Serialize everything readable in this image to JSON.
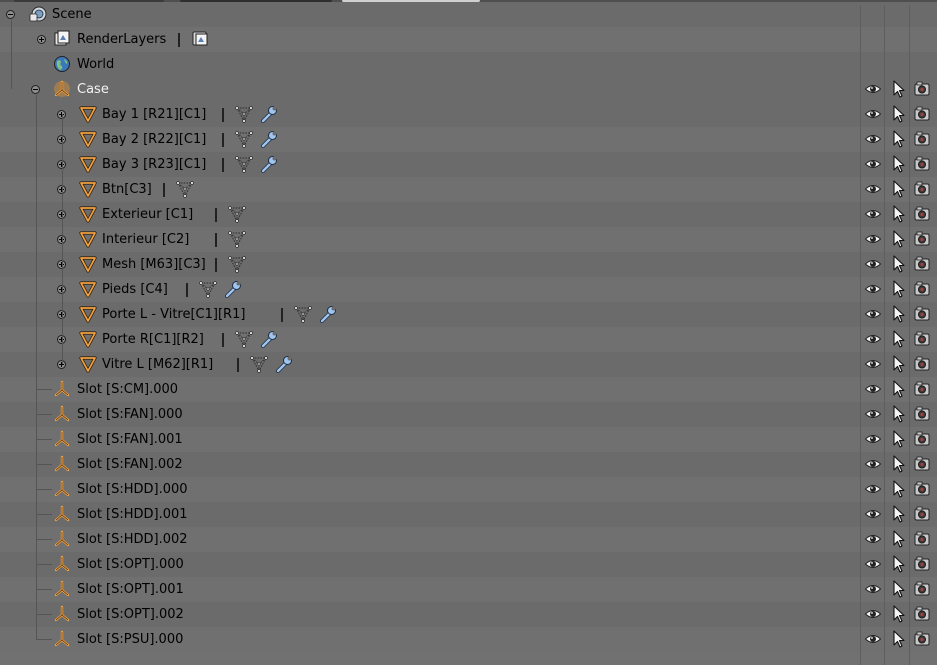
{
  "window": {
    "panel": "Outliner"
  },
  "colors": {
    "row_odd": "#707070",
    "row_even": "#6b6b6b",
    "active_text": "#f2f2f2",
    "object_orange": "#f0a040",
    "modifier_blue": "#9fc4ee"
  },
  "tree": {
    "scene": {
      "label": "Scene",
      "icon": "scene-icon"
    },
    "render_layers": {
      "label": "RenderLayers",
      "icon": "render-layers-icon"
    },
    "world": {
      "label": "World",
      "icon": "world-icon"
    },
    "case": {
      "label": "Case",
      "icon": "empty-object-icon"
    },
    "meshes": [
      {
        "label": "Bay 1 [R21][C1]",
        "modifier": true
      },
      {
        "label": "Bay 2 [R22][C1]",
        "modifier": true
      },
      {
        "label": "Bay 3 [R23][C1]",
        "modifier": true
      },
      {
        "label": "Btn[C3]",
        "modifier": false
      },
      {
        "label": "Exterieur [C1]",
        "modifier": false
      },
      {
        "label": "Interieur [C2]",
        "modifier": false
      },
      {
        "label": "Mesh [M63][C3]",
        "modifier": false
      },
      {
        "label": "Pieds [C4]",
        "modifier": true
      },
      {
        "label": "Porte L - Vitre[C1][R1]",
        "modifier": true
      },
      {
        "label": "Porte R[C1][R2]",
        "modifier": true
      },
      {
        "label": "Vitre L [M62][R1]",
        "modifier": true
      }
    ],
    "slots": [
      "Slot [S:CM].000",
      "Slot [S:FAN].000",
      "Slot [S:FAN].001",
      "Slot [S:FAN].002",
      "Slot [S:HDD].000",
      "Slot [S:HDD].001",
      "Slot [S:HDD].002",
      "Slot [S:OPT].000",
      "Slot [S:OPT].001",
      "Slot [S:OPT].002",
      "Slot [S:PSU].000"
    ]
  },
  "restriction_columns": [
    "visibility-eye-icon",
    "selectability-cursor-icon",
    "render-camera-icon"
  ]
}
